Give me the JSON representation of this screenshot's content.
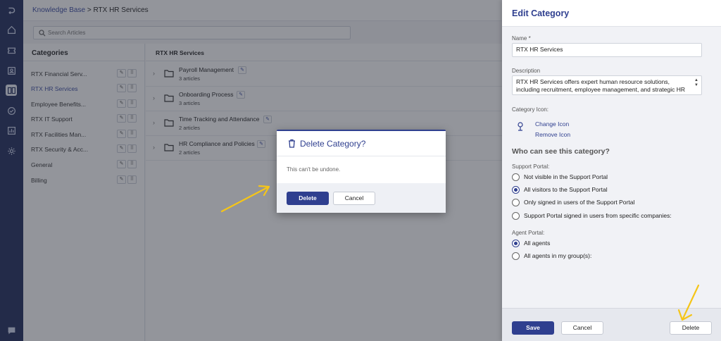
{
  "breadcrumb": {
    "root": "Knowledge Base",
    "separator": ">",
    "current": "RTX HR Services"
  },
  "search": {
    "placeholder": "Search Articles"
  },
  "categories": {
    "title": "Categories",
    "items": [
      {
        "label": "RTX Financial Serv...",
        "active": false
      },
      {
        "label": "RTX HR Services",
        "active": true
      },
      {
        "label": "Employee Benefits...",
        "active": false
      },
      {
        "label": "RTX IT Support",
        "active": false
      },
      {
        "label": "RTX Facilities Man...",
        "active": false
      },
      {
        "label": "RTX Security & Acc...",
        "active": false
      },
      {
        "label": "General",
        "active": false
      },
      {
        "label": "Billing",
        "active": false
      }
    ]
  },
  "articles": {
    "title": "RTX HR Services",
    "folders": [
      {
        "title": "Payroll Management",
        "count": "3 articles"
      },
      {
        "title": "Onboarding Process",
        "count": "3 articles"
      },
      {
        "title": "Time Tracking and Attendance",
        "count": "2 articles"
      },
      {
        "title": "HR Compliance and Policies",
        "count": "2 articles"
      }
    ]
  },
  "drawer": {
    "title": "Edit Category",
    "name_label": "Name *",
    "name_value": "RTX HR Services",
    "description_label": "Description",
    "description_value": "RTX HR Services offers expert human resource solutions, including recruitment, employee management, and strategic HR",
    "icon_label": "Category Icon:",
    "change_icon": "Change Icon",
    "remove_icon": "Remove Icon",
    "visibility_title": "Who can see this category?",
    "support_portal_label": "Support Portal:",
    "support_options": [
      {
        "label": "Not visible in the Support Portal",
        "selected": false
      },
      {
        "label": "All visitors to the Support Portal",
        "selected": true
      },
      {
        "label": "Only signed in users of the Support Portal",
        "selected": false
      },
      {
        "label": "Support Portal signed in users from specific companies:",
        "selected": false
      }
    ],
    "agent_portal_label": "Agent Portal:",
    "agent_options": [
      {
        "label": "All agents",
        "selected": true
      },
      {
        "label": "All agents in my group(s):",
        "selected": false
      }
    ],
    "save_label": "Save",
    "cancel_label": "Cancel",
    "delete_label": "Delete"
  },
  "modal": {
    "title": "Delete Category?",
    "message": "This can't be undone.",
    "delete_label": "Delete",
    "cancel_label": "Cancel"
  },
  "colors": {
    "rail": "#1e2a5a",
    "accent": "#2f3f8f",
    "annotation_arrow": "#f5c518"
  }
}
